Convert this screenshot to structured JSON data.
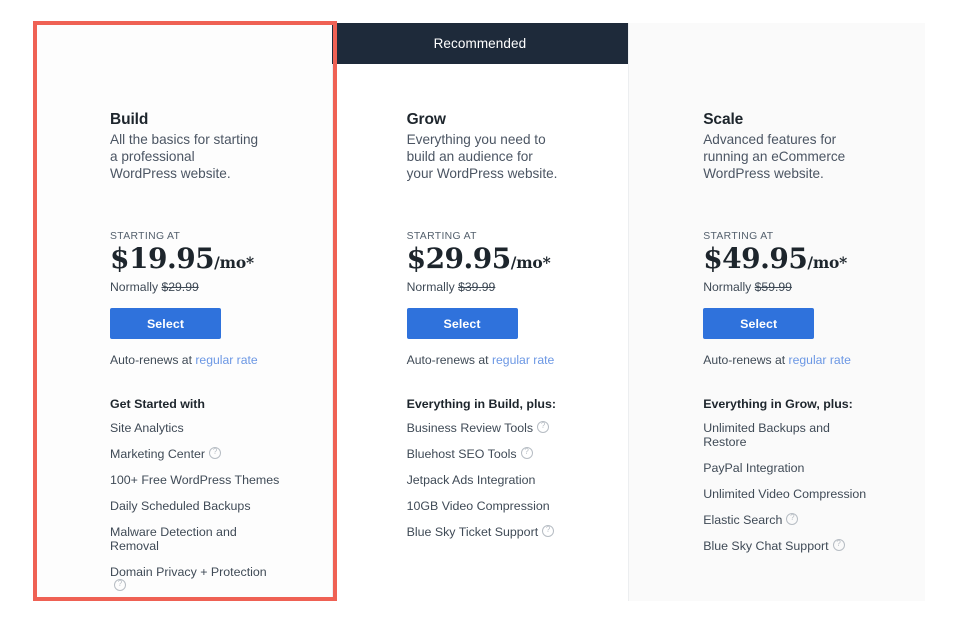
{
  "page": {
    "accent_blue": "#2f72dc",
    "link_blue": "#6b97e4",
    "ribbon_navy": "#1e2a3a",
    "highlight_red": "#ef6154"
  },
  "plans": [
    {
      "ribbon": "",
      "name": "Build",
      "description": "All the basics for starting a professional WordPress website.",
      "starting_at_label": "STARTING AT",
      "price": "$19.95",
      "price_suffix": "/mo*",
      "normally_label": "Normally",
      "normally_price": "$29.99",
      "select_label": "Select",
      "autorenew_text": "Auto-renews at",
      "autorenew_link": "regular rate",
      "features_heading": "Get Started with",
      "features": [
        {
          "label": "Site Analytics",
          "info": false
        },
        {
          "label": "Marketing Center",
          "info": true
        },
        {
          "label": "100+ Free WordPress Themes",
          "info": false
        },
        {
          "label": "Daily Scheduled Backups",
          "info": false
        },
        {
          "label": "Malware Detection and Removal",
          "info": false
        },
        {
          "label": "Domain Privacy + Protection",
          "info": true
        }
      ]
    },
    {
      "ribbon": "Recommended",
      "name": "Grow",
      "description": "Everything you need to build an audience for your WordPress website.",
      "starting_at_label": "STARTING AT",
      "price": "$29.95",
      "price_suffix": "/mo*",
      "normally_label": "Normally",
      "normally_price": "$39.99",
      "select_label": "Select",
      "autorenew_text": "Auto-renews at",
      "autorenew_link": "regular rate",
      "features_heading": "Everything in Build, plus:",
      "features": [
        {
          "label": "Business Review Tools",
          "info": true
        },
        {
          "label": "Bluehost SEO Tools",
          "info": true
        },
        {
          "label": "Jetpack Ads Integration",
          "info": false
        },
        {
          "label": "10GB Video Compression",
          "info": false
        },
        {
          "label": "Blue Sky Ticket Support",
          "info": true
        }
      ]
    },
    {
      "ribbon": "",
      "name": "Scale",
      "description": "Advanced features for running an eCommerce WordPress website.",
      "starting_at_label": "STARTING AT",
      "price": "$49.95",
      "price_suffix": "/mo*",
      "normally_label": "Normally",
      "normally_price": "$59.99",
      "select_label": "Select",
      "autorenew_text": "Auto-renews at",
      "autorenew_link": "regular rate",
      "features_heading": "Everything in Grow, plus:",
      "features": [
        {
          "label": "Unlimited Backups and Restore",
          "info": false
        },
        {
          "label": "PayPal Integration",
          "info": false
        },
        {
          "label": "Unlimited Video Compression",
          "info": false
        },
        {
          "label": "Elastic Search",
          "info": true
        },
        {
          "label": "Blue Sky Chat Support",
          "info": true
        }
      ]
    }
  ]
}
